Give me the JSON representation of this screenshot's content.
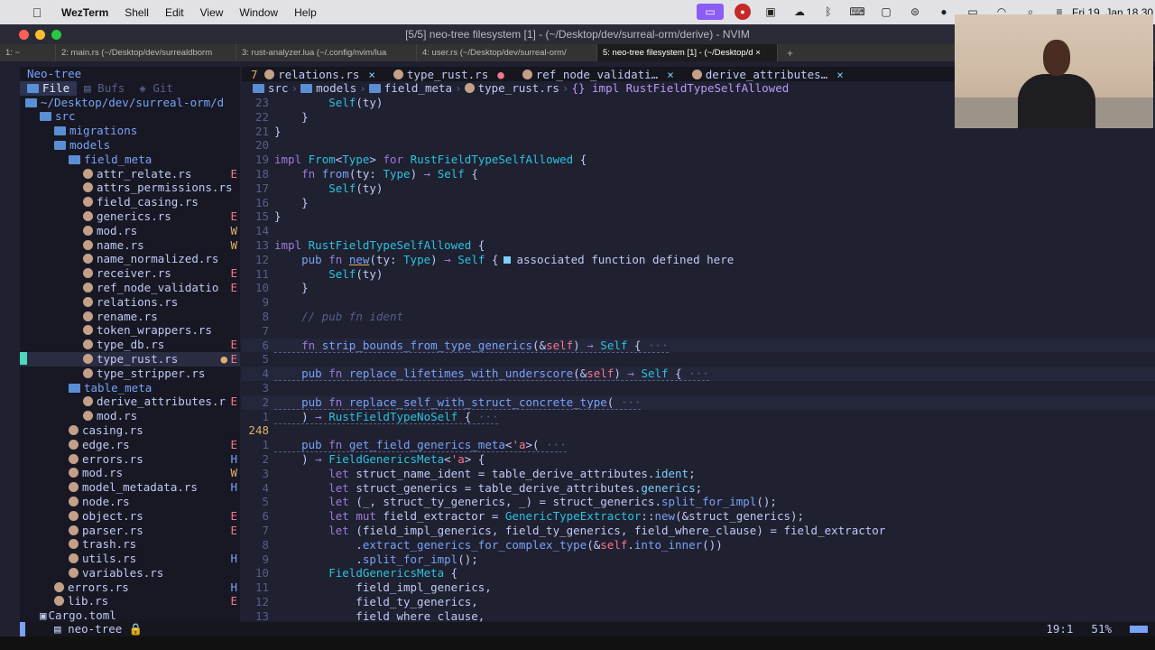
{
  "menubar": {
    "apple": "",
    "app_name": "WezTerm",
    "menus": [
      "Shell",
      "Edit",
      "View",
      "Window",
      "Help"
    ],
    "status_icons": [
      "screen-mirror-icon",
      "badge-icon",
      "capture-icon",
      "cloud-icon",
      "bluetooth-icon",
      "keyboard-icon",
      "display-icon",
      "controls-icon",
      "user-icon",
      "battery-icon",
      "wifi-icon",
      "search-icon",
      "control-center-icon"
    ],
    "clock": "Fri 19. Jan 18.30"
  },
  "window": {
    "title": "[5/5] neo-tree filesystem [1] - (~/Desktop/dev/surreal-orm/derive) - NVIM"
  },
  "term_tabs": [
    "1: ~",
    "2: main.rs (~/Desktop/dev/surrealdborm",
    "3: rust-analyzer.lua (~/.config/nvim/lua",
    "4: user.rs (~/Desktop/dev/surreal-orm/",
    "5: neo-tree filesystem [1] - (~/Desktop/d"
  ],
  "term_tab_close": "×",
  "term_tab_new": "+",
  "sidebar": {
    "title": "Neo-tree",
    "tabs": [
      "File",
      "Bufs",
      "Git"
    ],
    "root": "~/Desktop/dev/surreal-orm/d",
    "tree": [
      {
        "name": "src",
        "type": "folder",
        "depth": 1,
        "flag": ""
      },
      {
        "name": "migrations",
        "type": "folder",
        "depth": 2,
        "flag": ""
      },
      {
        "name": "models",
        "type": "folder",
        "depth": 2,
        "flag": ""
      },
      {
        "name": "field_meta",
        "type": "folder",
        "depth": 3,
        "flag": ""
      },
      {
        "name": "attr_relate.rs",
        "type": "file",
        "depth": 4,
        "flag": "E"
      },
      {
        "name": "attrs_permissions.rs",
        "type": "file",
        "depth": 4,
        "flag": ""
      },
      {
        "name": "field_casing.rs",
        "type": "file",
        "depth": 4,
        "flag": ""
      },
      {
        "name": "generics.rs",
        "type": "file",
        "depth": 4,
        "flag": "E"
      },
      {
        "name": "mod.rs",
        "type": "file",
        "depth": 4,
        "flag": "W"
      },
      {
        "name": "name.rs",
        "type": "file",
        "depth": 4,
        "flag": "W"
      },
      {
        "name": "name_normalized.rs",
        "type": "file",
        "depth": 4,
        "flag": ""
      },
      {
        "name": "receiver.rs",
        "type": "file",
        "depth": 4,
        "flag": "E"
      },
      {
        "name": "ref_node_validatio",
        "type": "file",
        "depth": 4,
        "flag": "E"
      },
      {
        "name": "relations.rs",
        "type": "file",
        "depth": 4,
        "flag": ""
      },
      {
        "name": "rename.rs",
        "type": "file",
        "depth": 4,
        "flag": ""
      },
      {
        "name": "token_wrappers.rs",
        "type": "file",
        "depth": 4,
        "flag": ""
      },
      {
        "name": "type_db.rs",
        "type": "file",
        "depth": 4,
        "flag": "E"
      },
      {
        "name": "type_rust.rs",
        "type": "file",
        "depth": 4,
        "flag": "E",
        "current": true,
        "modified": "●"
      },
      {
        "name": "type_stripper.rs",
        "type": "file",
        "depth": 4,
        "flag": ""
      },
      {
        "name": "table_meta",
        "type": "folder",
        "depth": 3,
        "flag": ""
      },
      {
        "name": "derive_attributes.r",
        "type": "file",
        "depth": 4,
        "flag": "E"
      },
      {
        "name": "mod.rs",
        "type": "file",
        "depth": 4,
        "flag": ""
      },
      {
        "name": "casing.rs",
        "type": "file",
        "depth": 3,
        "flag": ""
      },
      {
        "name": "edge.rs",
        "type": "file",
        "depth": 3,
        "flag": "E"
      },
      {
        "name": "errors.rs",
        "type": "file",
        "depth": 3,
        "flag": "H"
      },
      {
        "name": "mod.rs",
        "type": "file",
        "depth": 3,
        "flag": "W"
      },
      {
        "name": "model_metadata.rs",
        "type": "file",
        "depth": 3,
        "flag": "H"
      },
      {
        "name": "node.rs",
        "type": "file",
        "depth": 3,
        "flag": ""
      },
      {
        "name": "object.rs",
        "type": "file",
        "depth": 3,
        "flag": "E"
      },
      {
        "name": "parser.rs",
        "type": "file",
        "depth": 3,
        "flag": "E"
      },
      {
        "name": "trash.rs",
        "type": "file",
        "depth": 3,
        "flag": ""
      },
      {
        "name": "utils.rs",
        "type": "file",
        "depth": 3,
        "flag": "H"
      },
      {
        "name": "variables.rs",
        "type": "file",
        "depth": 3,
        "flag": ""
      },
      {
        "name": "errors.rs",
        "type": "file",
        "depth": 2,
        "flag": "H"
      },
      {
        "name": "lib.rs",
        "type": "file",
        "depth": 2,
        "flag": "E"
      },
      {
        "name": "Cargo.toml",
        "type": "toml",
        "depth": 1,
        "flag": ""
      }
    ]
  },
  "buffers": [
    {
      "num": "7",
      "name": "relations.rs",
      "mark": "×",
      "kind": "close"
    },
    {
      "num": "",
      "name": "type_rust.rs",
      "mark": "●",
      "kind": "modified"
    },
    {
      "num": "",
      "name": "ref_node_validati…",
      "mark": "×",
      "kind": "close"
    },
    {
      "num": "",
      "name": "derive_attributes…",
      "mark": "×",
      "kind": "close"
    }
  ],
  "breadcrumb": [
    "src",
    "models",
    "field_meta",
    "type_rust.rs",
    "{} impl RustFieldTypeSelfAllowed"
  ],
  "diagnostic": "associated function defined here",
  "code": [
    {
      "ln": "23",
      "html": "        <span class='t'>Self</span>(ty)"
    },
    {
      "ln": "22",
      "html": "    }"
    },
    {
      "ln": "21",
      "html": "}"
    },
    {
      "ln": "20",
      "html": ""
    },
    {
      "ln": "19",
      "html": "<span class='k'>impl</span> <span class='t'>From</span>&lt;<span class='t'>Type</span>&gt; <span class='k'>for</span> <span class='t'>RustFieldTypeSelfAllowed</span> {"
    },
    {
      "ln": "18",
      "html": "    <span class='k'>fn</span> <span class='f'>from</span>(ty: <span class='t'>Type</span>) <span class='k'>→</span> <span class='t'>Self</span> {"
    },
    {
      "ln": "17",
      "html": "        <span class='t'>Self</span>(ty)"
    },
    {
      "ln": "16",
      "html": "    }"
    },
    {
      "ln": "15",
      "html": "}"
    },
    {
      "ln": "14",
      "html": ""
    },
    {
      "ln": "13",
      "html": "<span class='k'>impl</span> <span class='t'>RustFieldTypeSelfAllowed</span> {"
    },
    {
      "ln": "12",
      "html": "    <span class='kb'>pub</span> <span class='k'>fn</span> <span class='f u'>new</span>(ty: <span class='t'>Type</span>) <span class='k'>→</span> <span class='t'>Self</span> {<span class='diag-ic'></span><span class='diag' data-diag='1'></span>"
    },
    {
      "ln": "11",
      "html": "        <span class='t'>Self</span>(ty)"
    },
    {
      "ln": "10",
      "html": "    }"
    },
    {
      "ln": "9",
      "html": ""
    },
    {
      "ln": "8",
      "html": "    <span class='c'>// pub fn ident</span>"
    },
    {
      "ln": "7",
      "html": ""
    },
    {
      "ln": "6",
      "html": "<span class='fold'>    <span class='k'>fn</span> <span class='f'>strip_bounds_from_type_generics</span>(&amp;<span class='s'>self</span>) <span class='k'>→</span> <span class='t'>Self</span> { <span class='dim'>···</span></span>",
      "hl": true
    },
    {
      "ln": "5",
      "html": ""
    },
    {
      "ln": "4",
      "html": "<span class='fold'>    <span class='kb'>pub</span> <span class='k'>fn</span> <span class='f'>replace_lifetimes_with_underscore</span>(&amp;<span class='s'>self</span>) <span class='k'>→</span> <span class='t'>Self</span> { <span class='dim'>···</span></span>",
      "hl": true
    },
    {
      "ln": "3",
      "html": ""
    },
    {
      "ln": "2",
      "html": "<span class='fold'>    <span class='kb'>pub</span> <span class='k'>fn</span> <span class='f'>replace_self_with_struct_concrete_type</span>( <span class='dim'>···</span></span>",
      "hl": true
    },
    {
      "ln": "1",
      "html": "<span class='fold'>    ) <span class='k'>→</span> <span class='t'>RustFieldTypeNoSelf</span> { <span class='dim'>···</span></span>"
    },
    {
      "ln": "248",
      "html": "",
      "cur": true
    },
    {
      "ln": "1",
      "html": "<span class='fold'>    <span class='kb'>pub</span> <span class='k'>fn</span> <span class='f'>get_field_generics_meta</span>&lt;<span class='s'>'a</span>&gt;( <span class='dim'>···</span></span>"
    },
    {
      "ln": "2",
      "html": "    ) <span class='k'>→</span> <span class='t'>FieldGenericsMeta</span>&lt;<span class='s'>'a</span>&gt; {"
    },
    {
      "ln": "3",
      "html": "        <span class='k'>let</span> struct_name_ident = table_derive_attributes.<span class='m'>ident</span>;"
    },
    {
      "ln": "4",
      "html": "        <span class='k'>let</span> struct_generics = table_derive_attributes.<span class='m'>generics</span>;"
    },
    {
      "ln": "5",
      "html": "        <span class='k'>let</span> (_, struct_ty_generics, _) = struct_generics.<span class='f'>split_for_impl</span>();"
    },
    {
      "ln": "6",
      "html": "        <span class='k'>let mut</span> field_extractor = <span class='t'>GenericTypeExtractor</span>::<span class='f'>new</span>(&amp;struct_generics);"
    },
    {
      "ln": "7",
      "html": "        <span class='k'>let</span> (field_impl_generics, field_ty_generics, field_where_clause) = field_extractor"
    },
    {
      "ln": "8",
      "html": "            .<span class='f'>extract_generics_for_complex_type</span>(&amp;<span class='s'>self</span>.<span class='f'>into_inner</span>())"
    },
    {
      "ln": "9",
      "html": "            .<span class='f'>split_for_impl</span>();"
    },
    {
      "ln": "10",
      "html": "        <span class='t'>FieldGenericsMeta</span> {"
    },
    {
      "ln": "11",
      "html": "            field_impl_generics,"
    },
    {
      "ln": "12",
      "html": "            field_ty_generics,"
    },
    {
      "ln": "13",
      "html": "            field_where_clause,"
    }
  ],
  "statusline": {
    "name": "neo-tree",
    "lock": "🔒",
    "position": "19:1",
    "percent": "51%"
  }
}
